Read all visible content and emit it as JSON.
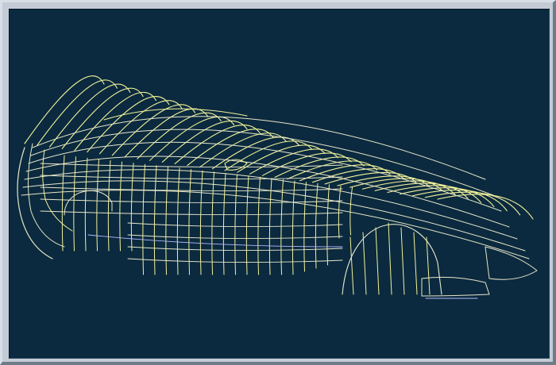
{
  "viewport": {
    "background": "#0b2a3f",
    "content": "car-body-wireframe",
    "colors": {
      "wire_primary": "#f2f29a",
      "wire_secondary": "#e8e7c9",
      "wire_dark": "#b9b9ff"
    }
  }
}
